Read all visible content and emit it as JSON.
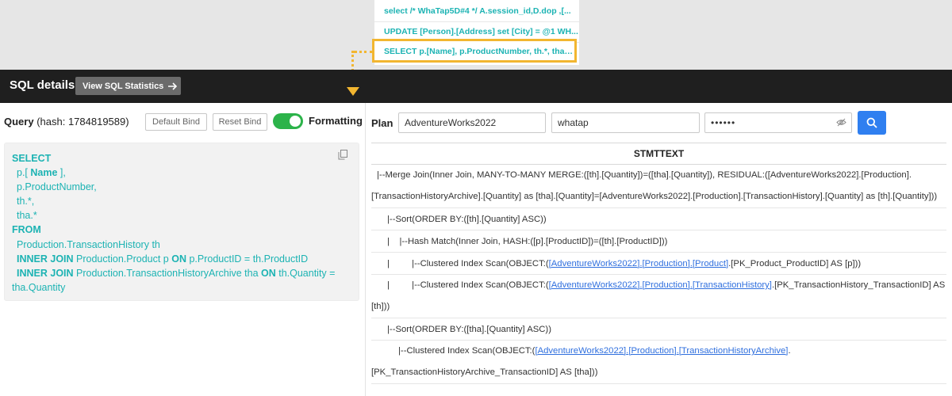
{
  "query_list": [
    "select /* WhaTap5D#4 */ A.session_id,D.dop ,[...",
    "UPDATE [Person].[Address] set [City] = @1 WH...",
    "SELECT p.[Name], p.ProductNumber, th.*, tha.*..."
  ],
  "header": {
    "title": "SQL details",
    "stats_button": "View SQL Statistics"
  },
  "query_panel": {
    "label": "Query",
    "hash_text": "(hash: 1784819589)",
    "default_bind": "Default Bind",
    "reset_bind": "Reset Bind",
    "formatting_label": "Formatting",
    "formatting_on": true,
    "sql": {
      "l1": "SELECT",
      "l2a": "p.[ ",
      "l2b": "Name",
      "l2c": " ],",
      "l3": "p.ProductNumber,",
      "l4": "th.*,",
      "l5": "tha.*",
      "l6": "FROM",
      "l7": "Production.TransactionHistory th",
      "l8kw1": "INNER JOIN",
      "l8a": " Production.Product p ",
      "l8kw2": "ON",
      "l8b": " p.ProductID = th.ProductID",
      "l9kw1": "INNER JOIN",
      "l9a": " Production.TransactionHistoryArchive tha ",
      "l9kw2": "ON",
      "l9b": " th.Quantity =",
      "l10": "tha.Quantity"
    }
  },
  "plan_panel": {
    "label": "Plan",
    "database": "AdventureWorks2022",
    "user": "whatap",
    "password_mask": "••••••",
    "column_header": "STMTTEXT",
    "rows": {
      "r1a": "|--Merge Join(Inner Join, MANY-TO-MANY MERGE:([th].[Quantity])=([tha].[Quantity]), RESIDUAL:([AdventureWorks2022].[Production].",
      "r1b": "[TransactionHistoryArchive].[Quantity] as [tha].[Quantity]=[AdventureWorks2022].[Production].[TransactionHistory].[Quantity] as [th].[Quantity]))",
      "r2": "|--Sort(ORDER BY:([th].[Quantity] ASC))",
      "r3": "|    |--Hash Match(Inner Join, HASH:([p].[ProductID])=([th].[ProductID]))",
      "r4pre": "|         |--Clustered Index Scan(OBJECT:(",
      "r4l1": "[AdventureWorks2022]",
      "r4sep1": ".",
      "r4l2": "[Production]",
      "r4sep2": ".",
      "r4l3": "[Product]",
      "r4post": ".[PK_Product_ProductID] AS [p]))",
      "r5pre": "|         |--Clustered Index Scan(OBJECT:(",
      "r5l1": "[AdventureWorks2022]",
      "r5sep1": ".",
      "r5l2": "[Production]",
      "r5sep2": ".",
      "r5l3": "[TransactionHistory]",
      "r5post": ".[PK_TransactionHistory_TransactionID] AS",
      "r5b": "[th]))",
      "r6": "|--Sort(ORDER BY:([tha].[Quantity] ASC))",
      "r7pre": "|--Clustered Index Scan(OBJECT:(",
      "r7l1": "[AdventureWorks2022]",
      "r7sep1": ".",
      "r7l2": "[Production]",
      "r7sep2": ".",
      "r7l3": "[TransactionHistoryArchive]",
      "r7post": ".",
      "r7b": "[PK_TransactionHistoryArchive_TransactionID] AS [tha]))"
    }
  },
  "colors": {
    "accent_teal": "#1cb3b3",
    "highlight_orange": "#f2b630",
    "toggle_green": "#2cb34a",
    "search_blue": "#2f7ff0",
    "link_blue": "#2f6fde"
  },
  "icons": [
    "arrow-right-icon",
    "copy-icon",
    "eye-off-icon",
    "search-icon"
  ]
}
